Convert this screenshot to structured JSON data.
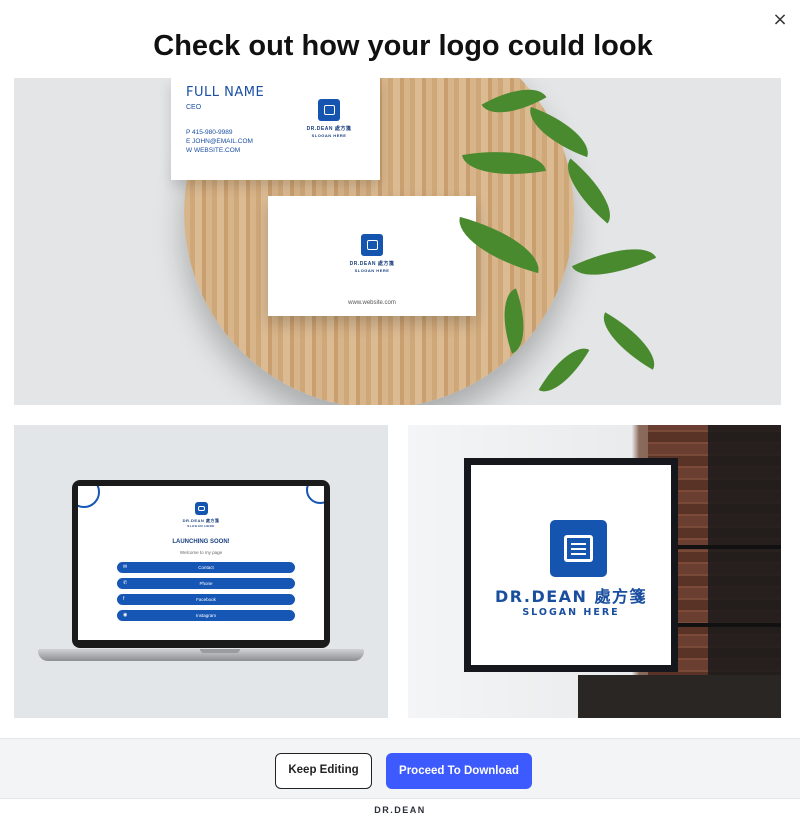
{
  "dialog": {
    "close_glyph": "×",
    "title": "Check out how your logo could look"
  },
  "mockups": {
    "business_card": {
      "full_name": "FULL NAME",
      "role": "CEO",
      "phone": "P  415-980-9989",
      "email": "E  JOHN@EMAIL.COM",
      "website_line": "W  WEBSITE.COM",
      "brand": "DR.DEAN 處方箋",
      "slogan": "SLOGAN HERE",
      "back_website": "www.website.com"
    },
    "laptop": {
      "brand": "DR.DEAN 處方箋",
      "slogan": "SLOGAN HERE",
      "headline": "LAUNCHING SOON!",
      "subheadline": "Welcome to my page",
      "links": [
        "Contact",
        "Phone",
        "Facebook",
        "Instagram"
      ]
    },
    "signboard": {
      "brand": "DR.DEAN 處方箋",
      "slogan": "SLOGAN HERE"
    }
  },
  "footer": {
    "keep_editing": "Keep Editing",
    "proceed": "Proceed To Download",
    "brand": "DR.DEAN"
  },
  "colors": {
    "primary_button": "#3d5afe",
    "logo_blue": "#1555b0"
  }
}
